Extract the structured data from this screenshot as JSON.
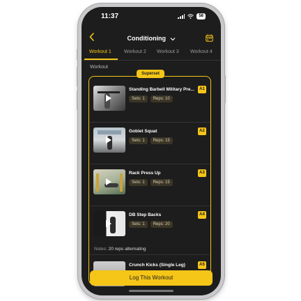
{
  "status_bar": {
    "time": "11:37",
    "battery": "58"
  },
  "header": {
    "title": "Conditioning",
    "back_icon": "chevron-left-icon",
    "calendar_icon": "calendar-icon"
  },
  "tabs": [
    {
      "label": "Workout 1",
      "active": true
    },
    {
      "label": "Workout 2",
      "active": false
    },
    {
      "label": "Workout 3",
      "active": false
    },
    {
      "label": "Workout 4",
      "active": false
    }
  ],
  "section_title": "Workout",
  "superset_label": "Superset",
  "exercises": [
    {
      "name": "Standing Barbell Military Pre...",
      "sets": "Sets: 1",
      "reps": "Reps: 10",
      "badge": "A1"
    },
    {
      "name": "Goblet Squat",
      "sets": "Sets: 1",
      "reps": "Reps: 15",
      "badge": "A2"
    },
    {
      "name": "Rack Press Up",
      "sets": "Sets: 1",
      "reps": "Reps: 15",
      "badge": "A3"
    },
    {
      "name": "DB Step Backs",
      "sets": "Sets: 1",
      "reps": "Reps: 20",
      "badge": "A4",
      "notes_label": "Notes:",
      "notes_value": "20 reps alternating"
    },
    {
      "name": "Crunch Kicks (Single Leg)",
      "badge": "A5"
    }
  ],
  "log_button": "Log This Workout",
  "colors": {
    "accent": "#f5c518",
    "background": "#1d1d1d",
    "chip_bg": "#3b3526"
  }
}
